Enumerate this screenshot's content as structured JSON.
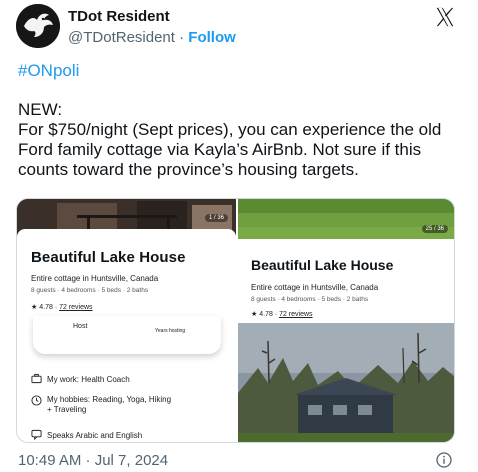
{
  "author": {
    "name": "TDot Resident",
    "handle": "@TDotResident",
    "separator": "·",
    "follow_label": "Follow",
    "avatar_icon": "bird-silhouette-avatar"
  },
  "header": {
    "platform_icon": "x-logo-icon"
  },
  "tweet": {
    "hashtag": "#ONpoli",
    "paragraph_1": "NEW:",
    "paragraph_2": "For $750/night (Sept prices), you can experience the old Ford family cottage via Kayla’s AirBnb. Not sure if this counts toward the province’s housing targets."
  },
  "media": {
    "left": {
      "counter": "1 / 36",
      "title": "Beautiful Lake House",
      "subtitle": "Entire cottage in Huntsville, Canada",
      "meta": "8 guests · 4 bedrooms · 5 beds · 2 baths",
      "rating_value": "4.78",
      "reviews": "72 reviews",
      "host_label": "Host",
      "years_label": "Years hosting",
      "work": "My work: Health Coach",
      "hobbies_line1": "My hobbies: Reading, Yoga, Hiking",
      "hobbies_line2": "+ Traveling",
      "languages": "Speaks Arabic and English"
    },
    "right_top": {
      "counter": "25 / 36",
      "title": "Beautiful Lake House",
      "subtitle": "Entire cottage in Huntsville, Canada",
      "meta": "8 guests · 4 bedrooms · 5 beds · 2 baths",
      "rating_value": "4.78",
      "reviews": "72 reviews"
    }
  },
  "footer": {
    "timestamp": "10:49 AM · Jul 7, 2024",
    "info_icon": "info-circle-icon"
  },
  "colors": {
    "link": "#1d9bf0",
    "text": "#0f1419",
    "muted": "#536471",
    "border": "#cfd9de"
  }
}
